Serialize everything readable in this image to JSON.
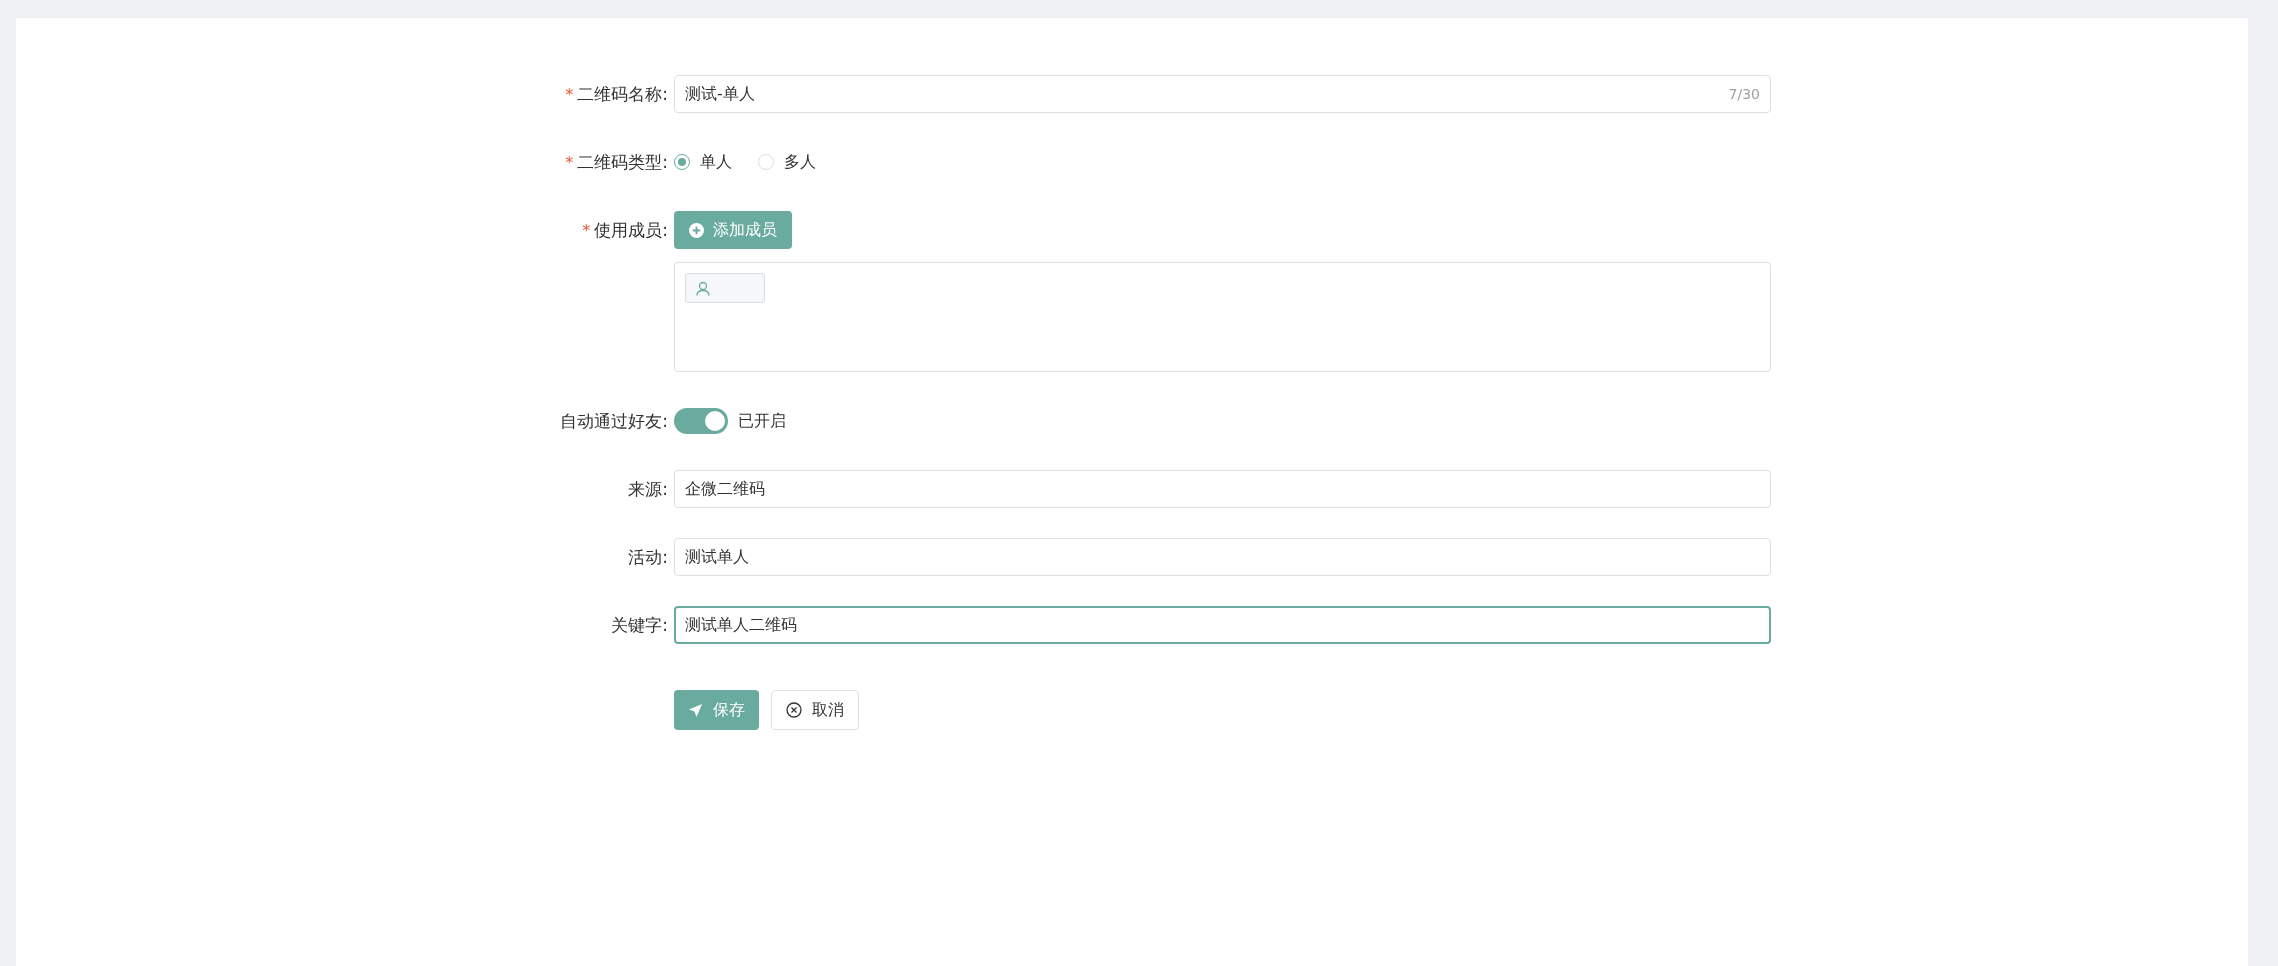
{
  "form": {
    "fields": [
      {
        "kind": "text",
        "label": "二维码名称:",
        "required_mark": "*",
        "value": "测试-单人",
        "counter": "7/30",
        "focused": false
      },
      {
        "kind": "radio",
        "label": "二维码类型:",
        "required_mark": "*",
        "options": [
          {
            "label": "单人",
            "selected": true
          },
          {
            "label": "多人",
            "selected": false
          }
        ]
      },
      {
        "kind": "members",
        "label": "使用成员:",
        "required_mark": "*",
        "button": "添加成员",
        "member_tags": [
          {
            "kind": "user"
          }
        ]
      },
      {
        "kind": "switch",
        "label": "自动通过好友:",
        "on": true,
        "status": "已开启"
      },
      {
        "kind": "text",
        "label": "来源:",
        "value": "企微二维码",
        "focused": false
      },
      {
        "kind": "text",
        "label": "活动:",
        "value": "测试单人",
        "focused": false
      },
      {
        "kind": "text",
        "label": "关键字:",
        "value": "测试单人二维码",
        "focused": true
      }
    ],
    "buttons": [
      {
        "kind": "primary",
        "label": "保存"
      },
      {
        "kind": "default",
        "label": "取消"
      }
    ]
  }
}
